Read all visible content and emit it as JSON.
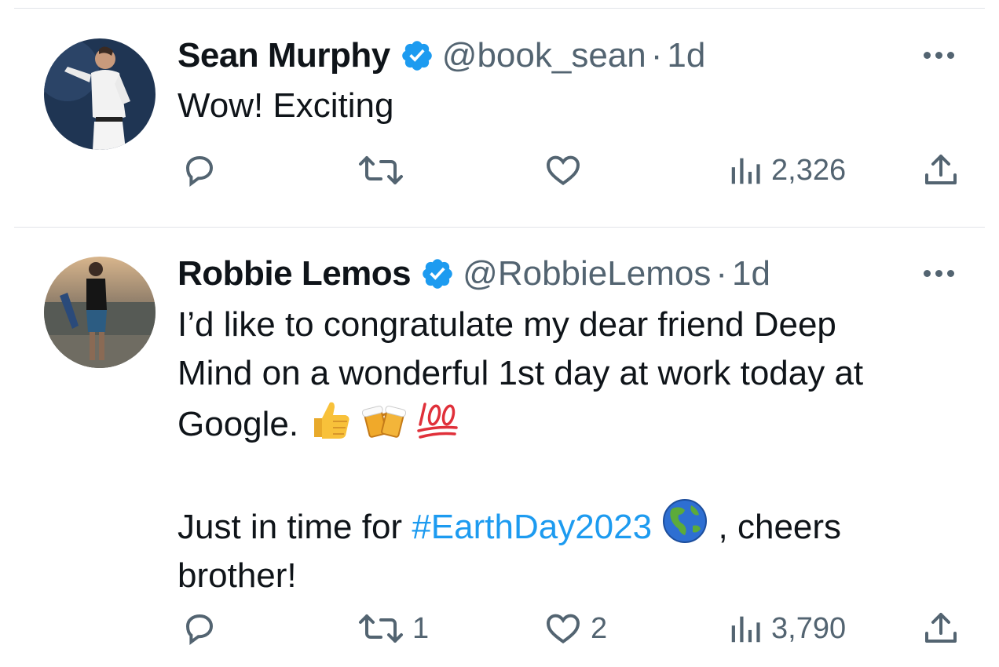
{
  "colors": {
    "text": "#0f1419",
    "muted": "#536471",
    "link": "#1d9bf0",
    "divider": "#e1e4e8",
    "verified": "#1d9bf0"
  },
  "tweets": [
    {
      "name": "Sean Murphy",
      "handle": "@book_sean",
      "separator": "·",
      "time": "1d",
      "verified_icon": "verified-badge-icon",
      "text": {
        "line1": "Wow! Exciting"
      },
      "actions": {
        "reply": "",
        "retweet": "",
        "like": "",
        "views": "2,326"
      }
    },
    {
      "name": "Robbie Lemos",
      "handle": "@RobbieLemos",
      "separator": "·",
      "time": "1d",
      "verified_icon": "verified-badge-icon",
      "text": {
        "line1": "I’d like to congratulate my dear friend Deep",
        "line2": "Mind on a wonderful 1st day at work today at",
        "line3": "Google.",
        "line3_emojis": [
          "thumbs-up-emoji",
          "clinking-beer-mugs-emoji",
          "hundred-points-emoji"
        ],
        "para2_prefix": "Just in time for ",
        "hashtag": "#EarthDay2023",
        "globe_emoji": "globe-americas-emoji",
        "para2_suffix": " , cheers",
        "para2_line2": "brother!"
      },
      "actions": {
        "reply": "",
        "retweet": "1",
        "like": "2",
        "views": "3,790"
      }
    }
  ]
}
